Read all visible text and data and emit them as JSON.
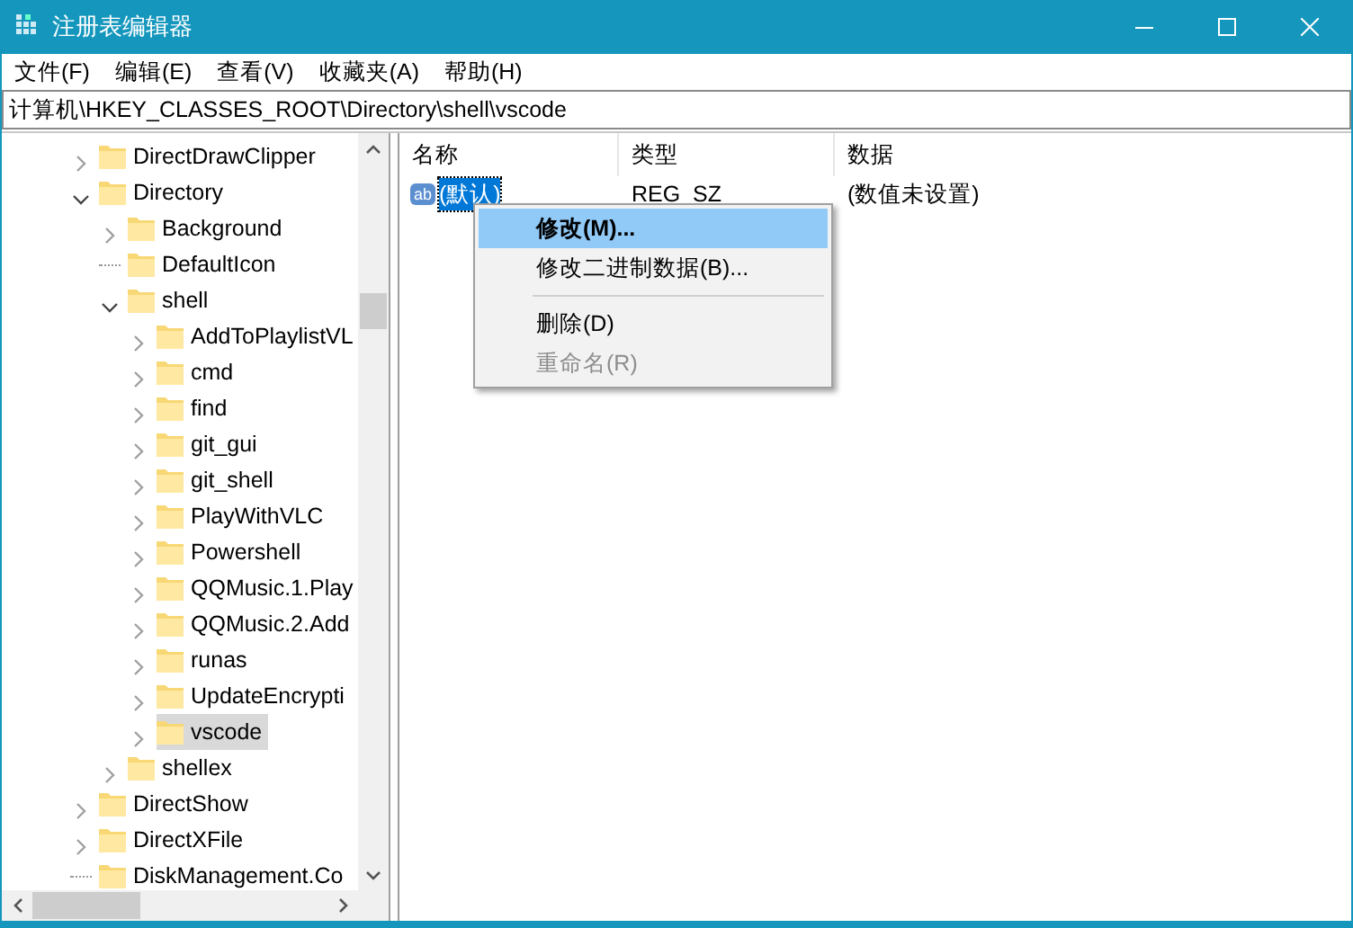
{
  "window": {
    "title": "注册表编辑器"
  },
  "menu": [
    "文件(F)",
    "编辑(E)",
    "查看(V)",
    "收藏夹(A)",
    "帮助(H)"
  ],
  "address": "计算机\\HKEY_CLASSES_ROOT\\Directory\\shell\\vscode",
  "tree": [
    {
      "label": "DirectDrawClipper",
      "kind": "branch",
      "expanded": false,
      "selected": false
    },
    {
      "label": "Directory",
      "kind": "branch",
      "expanded": true,
      "selected": false,
      "children": [
        {
          "label": "Background",
          "kind": "branch",
          "expanded": false,
          "selected": false
        },
        {
          "label": "DefaultIcon",
          "kind": "leaf",
          "selected": false
        },
        {
          "label": "shell",
          "kind": "branch",
          "expanded": true,
          "selected": false,
          "children": [
            {
              "label": "AddToPlaylistVL",
              "kind": "branch",
              "expanded": false,
              "selected": false
            },
            {
              "label": "cmd",
              "kind": "branch",
              "expanded": false,
              "selected": false
            },
            {
              "label": "find",
              "kind": "branch",
              "expanded": false,
              "selected": false
            },
            {
              "label": "git_gui",
              "kind": "branch",
              "expanded": false,
              "selected": false
            },
            {
              "label": "git_shell",
              "kind": "branch",
              "expanded": false,
              "selected": false
            },
            {
              "label": "PlayWithVLC",
              "kind": "branch",
              "expanded": false,
              "selected": false
            },
            {
              "label": "Powershell",
              "kind": "branch",
              "expanded": false,
              "selected": false
            },
            {
              "label": "QQMusic.1.Play",
              "kind": "branch",
              "expanded": false,
              "selected": false
            },
            {
              "label": "QQMusic.2.Add",
              "kind": "branch",
              "expanded": false,
              "selected": false
            },
            {
              "label": "runas",
              "kind": "branch",
              "expanded": false,
              "selected": false
            },
            {
              "label": "UpdateEncrypti",
              "kind": "branch",
              "expanded": false,
              "selected": false
            },
            {
              "label": "vscode",
              "kind": "branch",
              "expanded": false,
              "selected": true
            }
          ]
        },
        {
          "label": "shellex",
          "kind": "branch",
          "expanded": false,
          "selected": false
        }
      ]
    },
    {
      "label": "DirectShow",
      "kind": "branch",
      "expanded": false,
      "selected": false
    },
    {
      "label": "DirectXFile",
      "kind": "branch",
      "expanded": false,
      "selected": false
    },
    {
      "label": "DiskManagement.Co",
      "kind": "leaf",
      "selected": false
    }
  ],
  "table": {
    "columns": [
      "名称",
      "类型",
      "数据"
    ],
    "rows": [
      {
        "icon_label": "ab",
        "name": "(默认)",
        "type": "REG_SZ",
        "data": "(数值未设置)",
        "selected": true
      }
    ]
  },
  "context_menu": [
    {
      "kind": "item",
      "label": "修改(M)...",
      "default": true,
      "selected": true,
      "disabled": false
    },
    {
      "kind": "item",
      "label": "修改二进制数据(B)...",
      "default": false,
      "selected": false,
      "disabled": false
    },
    {
      "kind": "separator"
    },
    {
      "kind": "item",
      "label": "删除(D)",
      "default": false,
      "selected": false,
      "disabled": false
    },
    {
      "kind": "item",
      "label": "重命名(R)",
      "default": false,
      "selected": false,
      "disabled": true
    }
  ]
}
